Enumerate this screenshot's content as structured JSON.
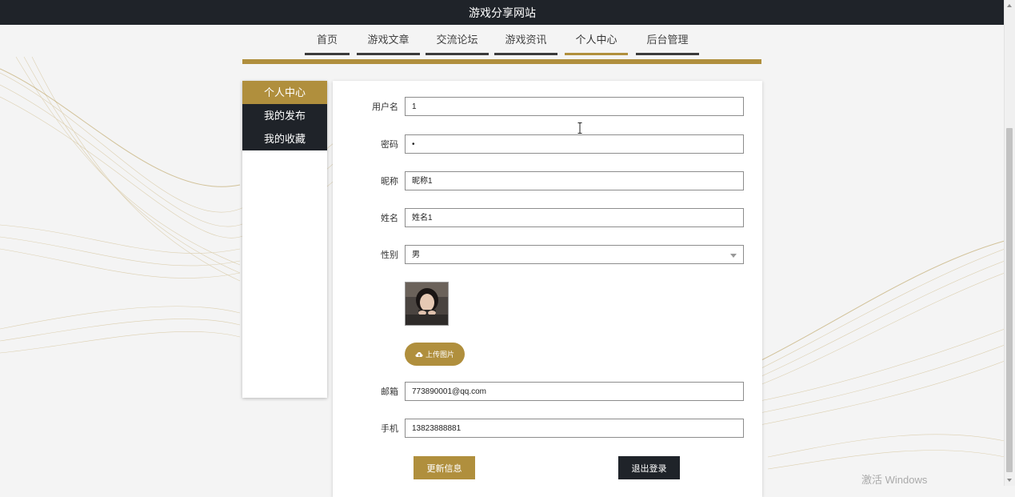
{
  "header": {
    "title": "游戏分享网站"
  },
  "nav": {
    "items": [
      {
        "label": "首页",
        "active": false
      },
      {
        "label": "游戏文章",
        "active": false
      },
      {
        "label": "交流论坛",
        "active": false
      },
      {
        "label": "游戏资讯",
        "active": false
      },
      {
        "label": "个人中心",
        "active": true
      },
      {
        "label": "后台管理",
        "active": false
      }
    ]
  },
  "sidebar": {
    "items": [
      {
        "label": "个人中心",
        "active": true
      },
      {
        "label": "我的发布",
        "active": false
      },
      {
        "label": "我的收藏",
        "active": false
      }
    ]
  },
  "form": {
    "username": {
      "label": "用户名",
      "value": "1"
    },
    "password": {
      "label": "密码",
      "value": "•"
    },
    "nickname": {
      "label": "昵称",
      "value": "昵称1"
    },
    "name": {
      "label": "姓名",
      "value": "姓名1"
    },
    "gender": {
      "label": "性别",
      "value": "男"
    },
    "upload_label": "上传图片",
    "email": {
      "label": "邮箱",
      "value": "773890001@qq.com"
    },
    "phone": {
      "label": "手机",
      "value": "13823888881"
    },
    "update_label": "更新信息",
    "logout_label": "退出登录"
  },
  "watermark": "激活 Windows",
  "colors": {
    "accent": "#b08f3d",
    "dark": "#1f2329"
  }
}
